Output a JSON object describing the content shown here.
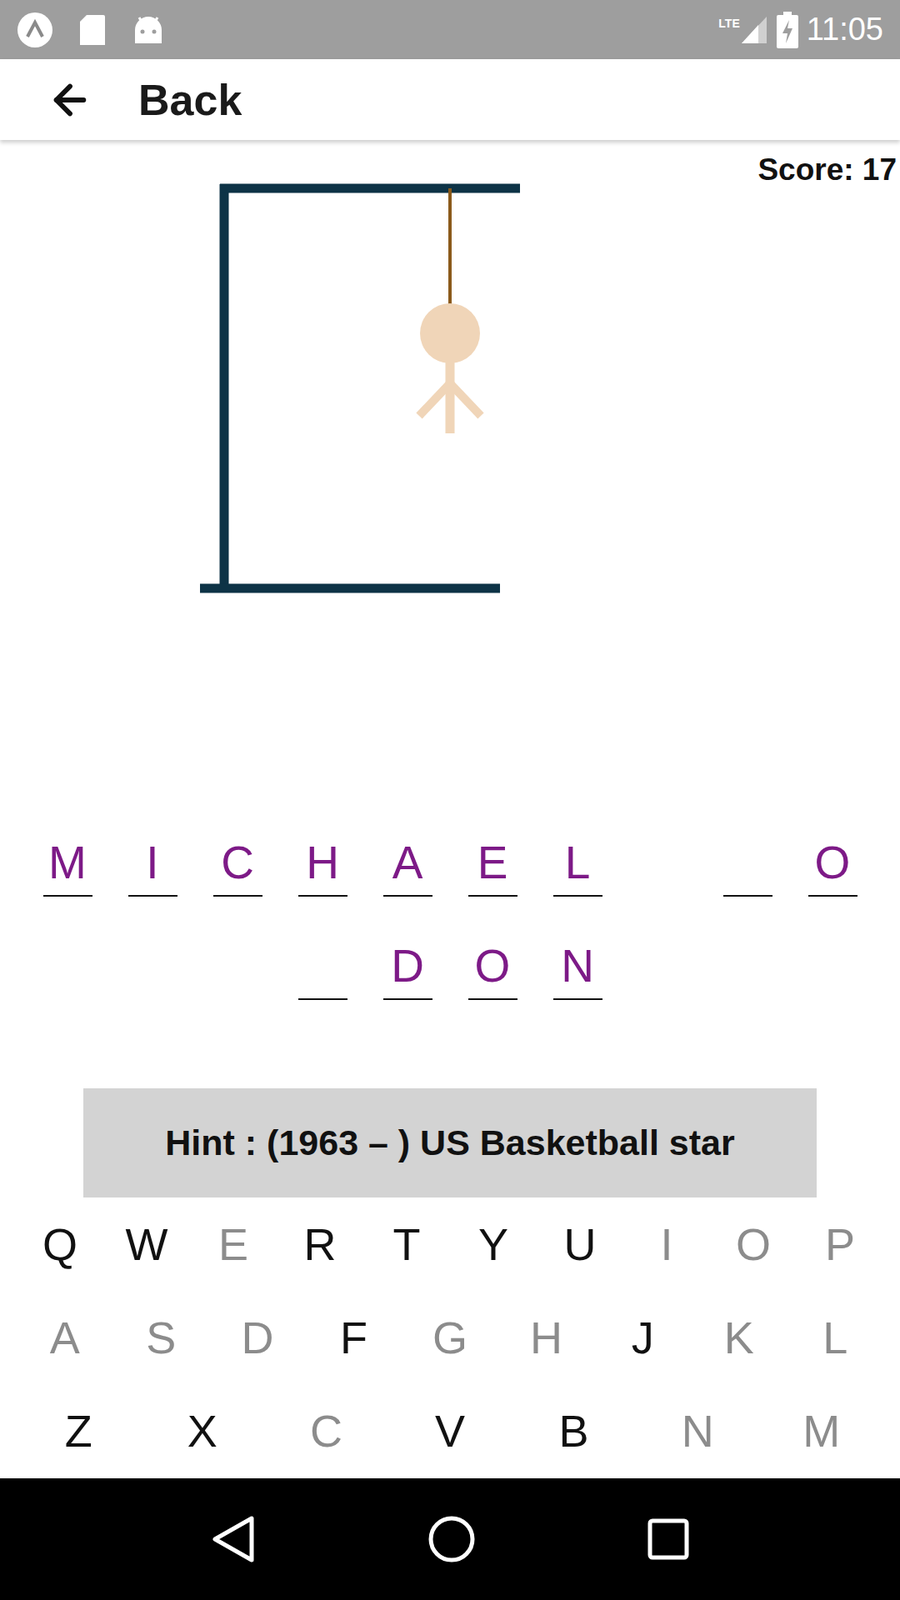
{
  "status_bar": {
    "network": "LTE",
    "time": "11:05"
  },
  "app_bar": {
    "back_label": "Back"
  },
  "score": "Score: 17",
  "hangman": {
    "parts_shown": 4
  },
  "word_rows": [
    [
      {
        "letter": "M",
        "kind": "letter"
      },
      {
        "letter": "I",
        "kind": "letter"
      },
      {
        "letter": "C",
        "kind": "letter"
      },
      {
        "letter": "H",
        "kind": "letter"
      },
      {
        "letter": "A",
        "kind": "letter"
      },
      {
        "letter": "E",
        "kind": "letter"
      },
      {
        "letter": "L",
        "kind": "letter"
      },
      {
        "letter": "",
        "kind": "space"
      },
      {
        "letter": "",
        "kind": "letter"
      },
      {
        "letter": "O",
        "kind": "letter"
      }
    ],
    [
      {
        "letter": "",
        "kind": "letter"
      },
      {
        "letter": "D",
        "kind": "letter"
      },
      {
        "letter": "O",
        "kind": "letter"
      },
      {
        "letter": "N",
        "kind": "letter"
      }
    ]
  ],
  "hint": "Hint : (1963 – ) US Basketball star",
  "keyboard": [
    [
      {
        "key": "Q",
        "used": false
      },
      {
        "key": "W",
        "used": false
      },
      {
        "key": "E",
        "used": true
      },
      {
        "key": "R",
        "used": false
      },
      {
        "key": "T",
        "used": false
      },
      {
        "key": "Y",
        "used": false
      },
      {
        "key": "U",
        "used": false
      },
      {
        "key": "I",
        "used": true
      },
      {
        "key": "O",
        "used": true
      },
      {
        "key": "P",
        "used": true
      }
    ],
    [
      {
        "key": "A",
        "used": true
      },
      {
        "key": "S",
        "used": true
      },
      {
        "key": "D",
        "used": true
      },
      {
        "key": "F",
        "used": false
      },
      {
        "key": "G",
        "used": true
      },
      {
        "key": "H",
        "used": true
      },
      {
        "key": "J",
        "used": false
      },
      {
        "key": "K",
        "used": true
      },
      {
        "key": "L",
        "used": true
      }
    ],
    [
      {
        "key": "Z",
        "used": false
      },
      {
        "key": "X",
        "used": false
      },
      {
        "key": "C",
        "used": true
      },
      {
        "key": "V",
        "used": false
      },
      {
        "key": "B",
        "used": false
      },
      {
        "key": "N",
        "used": true
      },
      {
        "key": "M",
        "used": true
      }
    ]
  ]
}
